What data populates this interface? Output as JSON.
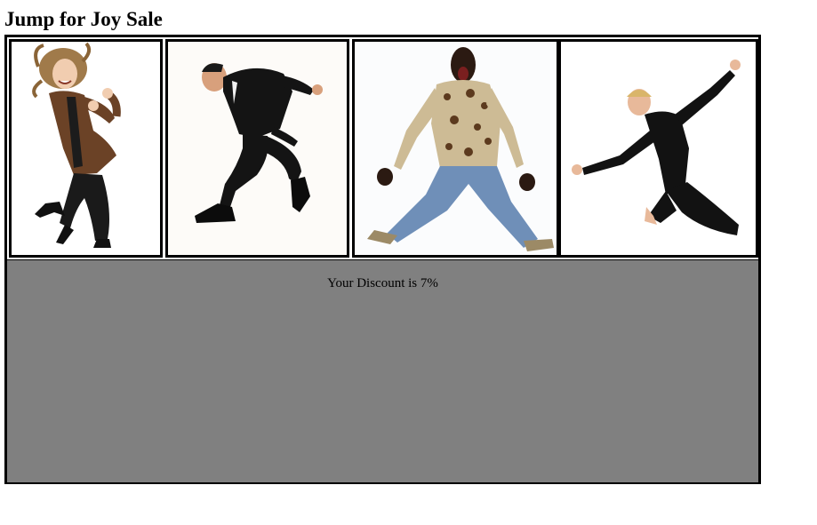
{
  "page": {
    "title": "Jump for Joy Sale"
  },
  "photos": [
    {
      "subject": "woman-brown-jacket-jumping"
    },
    {
      "subject": "man-black-suit-jumping"
    },
    {
      "subject": "man-patterned-shirt-jeans-jumping"
    },
    {
      "subject": "woman-black-leotard-leaping"
    }
  ],
  "discount": {
    "message": "Your Discount is 7%"
  },
  "colors": {
    "panel_background": "#808080",
    "border": "#000000"
  }
}
